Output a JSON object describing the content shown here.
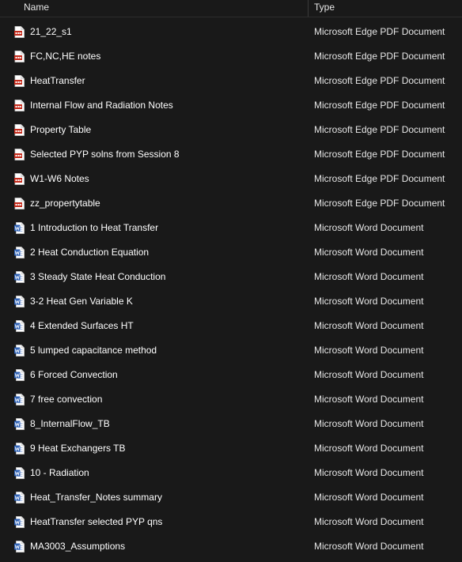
{
  "columns": {
    "name": "Name",
    "type": "Type"
  },
  "colors": {
    "background": "#191919",
    "text": "#ffffff",
    "pdf_icon": "#c42b1c",
    "word_icon": "#2b5fb4"
  },
  "files": [
    {
      "name": "21_22_s1",
      "type": "Microsoft Edge PDF Document",
      "icon": "pdf-icon"
    },
    {
      "name": "FC,NC,HE notes",
      "type": "Microsoft Edge PDF Document",
      "icon": "pdf-icon"
    },
    {
      "name": "HeatTransfer",
      "type": "Microsoft Edge PDF Document",
      "icon": "pdf-icon"
    },
    {
      "name": "Internal Flow and Radiation Notes",
      "type": "Microsoft Edge PDF Document",
      "icon": "pdf-icon"
    },
    {
      "name": "Property Table",
      "type": "Microsoft Edge PDF Document",
      "icon": "pdf-icon"
    },
    {
      "name": "Selected PYP solns from Session 8",
      "type": "Microsoft Edge PDF Document",
      "icon": "pdf-icon"
    },
    {
      "name": "W1-W6 Notes",
      "type": "Microsoft Edge PDF Document",
      "icon": "pdf-icon"
    },
    {
      "name": "zz_propertytable",
      "type": "Microsoft Edge PDF Document",
      "icon": "pdf-icon"
    },
    {
      "name": "1 Introduction to Heat Transfer",
      "type": "Microsoft Word Document",
      "icon": "word-icon"
    },
    {
      "name": "2 Heat Conduction Equation",
      "type": "Microsoft Word Document",
      "icon": "word-icon"
    },
    {
      "name": "3 Steady State Heat Conduction",
      "type": "Microsoft Word Document",
      "icon": "word-icon"
    },
    {
      "name": "3-2 Heat Gen Variable K",
      "type": "Microsoft Word Document",
      "icon": "word-icon"
    },
    {
      "name": "4 Extended Surfaces HT",
      "type": "Microsoft Word Document",
      "icon": "word-icon"
    },
    {
      "name": "5 lumped capacitance method",
      "type": "Microsoft Word Document",
      "icon": "word-icon"
    },
    {
      "name": "6 Forced Convection",
      "type": "Microsoft Word Document",
      "icon": "word-icon"
    },
    {
      "name": "7 free convection",
      "type": "Microsoft Word Document",
      "icon": "word-icon"
    },
    {
      "name": "8_InternalFlow_TB",
      "type": "Microsoft Word Document",
      "icon": "word-icon"
    },
    {
      "name": "9 Heat Exchangers TB",
      "type": "Microsoft Word Document",
      "icon": "word-icon"
    },
    {
      "name": "10 - Radiation",
      "type": "Microsoft Word Document",
      "icon": "word-icon"
    },
    {
      "name": "Heat_Transfer_Notes summary",
      "type": "Microsoft Word Document",
      "icon": "word-icon"
    },
    {
      "name": "HeatTransfer selected PYP qns",
      "type": "Microsoft Word Document",
      "icon": "word-icon"
    },
    {
      "name": "MA3003_Assumptions",
      "type": "Microsoft Word Document",
      "icon": "word-icon"
    }
  ]
}
